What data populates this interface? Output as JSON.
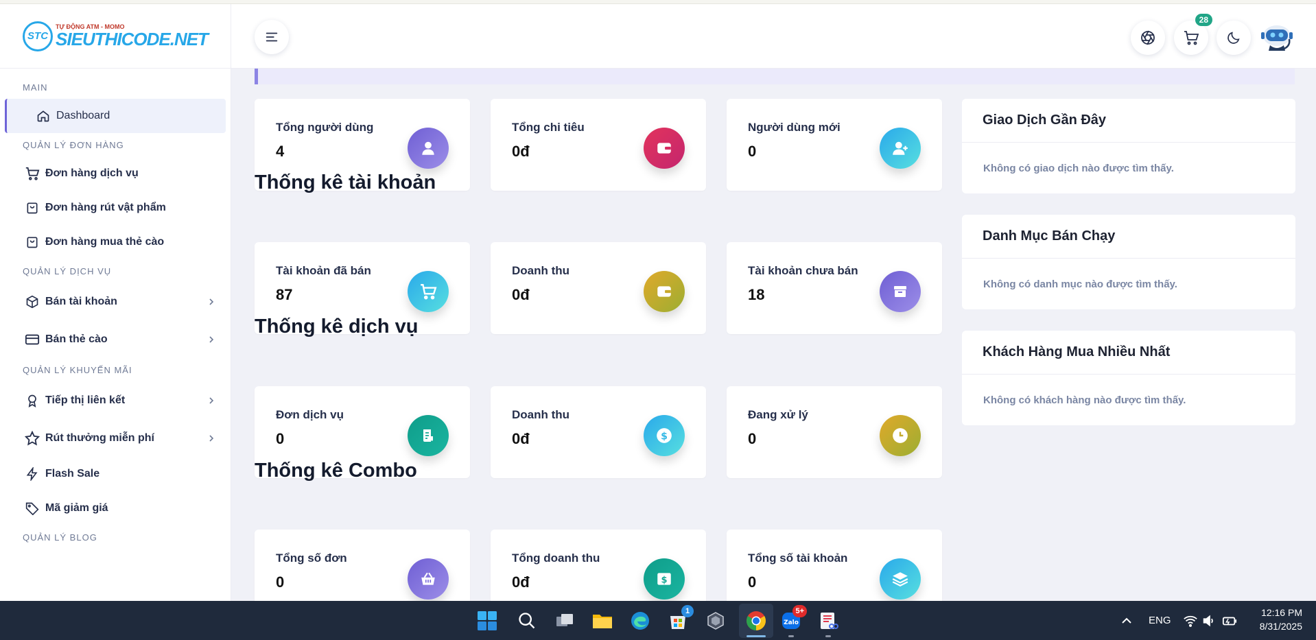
{
  "logo": {
    "badge": "STC",
    "small": "TỰ ĐỘNG ATM - MOMO",
    "big": "SIEUTHICODE.NET"
  },
  "sidebar": {
    "sections": [
      {
        "title": "MAIN",
        "items": [
          {
            "label": "Dashboard",
            "icon": "home-icon",
            "active": true
          }
        ]
      },
      {
        "title": "QUẢN LÝ ĐƠN HÀNG",
        "items": [
          {
            "label": "Đơn hàng dịch vụ",
            "icon": "cart-icon"
          },
          {
            "label": "Đơn hàng rút vật phẩm",
            "icon": "shopping-bag-icon"
          },
          {
            "label": "Đơn hàng mua thẻ cào",
            "icon": "shopping-bag-icon"
          }
        ]
      },
      {
        "title": "QUẢN LÝ DỊCH VỤ",
        "items": [
          {
            "label": "Bán tài khoản",
            "icon": "box-icon",
            "chevron": true
          },
          {
            "label": "Bán thẻ cào",
            "icon": "credit-card-icon",
            "chevron": true
          }
        ]
      },
      {
        "title": "QUẢN LÝ KHUYẾN MÃI",
        "items": [
          {
            "label": "Tiếp thị liên kết",
            "icon": "award-icon",
            "chevron": true
          },
          {
            "label": "Rút thưởng miễn phí",
            "icon": "star-icon",
            "chevron": true
          },
          {
            "label": "Flash Sale",
            "icon": "lightning-icon"
          },
          {
            "label": "Mã giảm giá",
            "icon": "tag-icon"
          }
        ]
      },
      {
        "title": "QUẢN LÝ BLOG",
        "items": []
      }
    ]
  },
  "header": {
    "cart_count": "28"
  },
  "overview": {
    "cards": [
      {
        "label": "Tổng người dùng",
        "value": "4",
        "icon": "user-icon"
      },
      {
        "label": "Tổng chi tiêu",
        "value": "0đ",
        "icon": "wallet-icon"
      },
      {
        "label": "Người dùng mới",
        "value": "0",
        "icon": "user-plus-icon"
      }
    ]
  },
  "account_stats": {
    "title": "Thống kê tài khoản",
    "cards": [
      {
        "label": "Tài khoản đã bán",
        "value": "87",
        "icon": "cart-icon"
      },
      {
        "label": "Doanh thu",
        "value": "0đ",
        "icon": "wallet-icon"
      },
      {
        "label": "Tài khoản chưa bán",
        "value": "18",
        "icon": "archive-icon"
      }
    ]
  },
  "service_stats": {
    "title": "Thống kê dịch vụ",
    "cards": [
      {
        "label": "Đơn dịch vụ",
        "value": "0",
        "icon": "receipt-icon"
      },
      {
        "label": "Doanh thu",
        "value": "0đ",
        "icon": "dollar-icon"
      },
      {
        "label": "Đang xử lý",
        "value": "0",
        "icon": "clock-icon"
      }
    ]
  },
  "combo_stats": {
    "title": "Thống kê Combo",
    "cards": [
      {
        "label": "Tổng số đơn",
        "value": "0",
        "icon": "basket-icon"
      },
      {
        "label": "Tổng doanh thu",
        "value": "0đ",
        "icon": "money-icon"
      },
      {
        "label": "Tổng số tài khoản",
        "value": "0",
        "icon": "layers-icon"
      }
    ]
  },
  "panels": [
    {
      "title": "Giao Dịch Gần Đây",
      "empty": "Không có giao dịch nào được tìm thấy."
    },
    {
      "title": "Danh Mục Bán Chạy",
      "empty": "Không có danh mục nào được tìm thấy."
    },
    {
      "title": "Khách Hàng Mua Nhiều Nhất",
      "empty": "Không có khách hàng nào được tìm thấy."
    }
  ],
  "taskbar": {
    "store_badge": "1",
    "zalo_badge": "5+",
    "zalo_label": "Zalo",
    "language": "ENG",
    "time": "12:16 PM",
    "date": "8/31/2025"
  },
  "colors": {
    "accent": "#6e64d8",
    "badge_green": "#21a587",
    "taskbar": "#1f2a3c"
  }
}
